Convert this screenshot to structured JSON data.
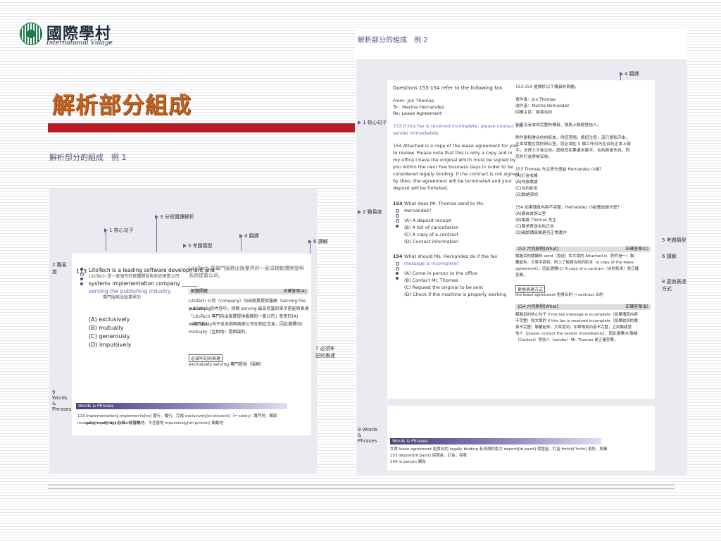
{
  "logo": {
    "cn": "國際學村",
    "en": "International Village"
  },
  "title": "解析部分組成",
  "left": {
    "example_label": "解析部分的組成　例 1",
    "annotations": {
      "a1": "1 核心句子",
      "a2": "2 難易度",
      "a3": "3 分段閱讀解析",
      "a4": "4 翻譯",
      "a5": "5 考題類型",
      "a6": "6 講解",
      "a7": "7 必須牢記的表達",
      "a9": "9 Words & Phrases"
    },
    "question": {
      "number": "113",
      "line1": "LitoTech is a leading software development and",
      "line1_note": "LitoTech 是一家領先的軟體開發與系統建置公司",
      "line2": "systems implementation company ______",
      "line3": "serving the publishing industry.",
      "line3_note": "專門服務出版業界的",
      "options": [
        "(A) exclusively",
        "(B) mutually",
        "(C) generously",
        "(D) impulsively"
      ]
    },
    "translation": "LitoTech 是專門服務出版業界的一家卓越軟體開發與系統建置公司。",
    "analysis_tag": "解題關鍵",
    "analysis_level": "正確答案(A)",
    "analysis_text": [
      "LitoTech 公司（company）向出版業提供服務（serving the publishing",
      "industry）的內容中，修飾 serving 最為恰當的單字是能夠表達",
      "「LitoTech 專門向出版業提供服務的一家公司」意思的(A) exclusively",
      "（專門地）。句子並未指明兩家公司在相互交易，因此選擇(B)",
      "mutually（互相地）是錯誤的。"
    ],
    "memo_label": "必須牢記的表達",
    "memo_text": "exclusively serving 專門提供（服務）",
    "wp_bar": "Words & Phrases",
    "wp_lines": [
      "113  implementation[ˌɪmpləmenˈteʃən] 實行、履行、完成  exclusively[ɪkˈsklusɪvlɪ]（= solely）專門地、獨家  mutually[ˈmjutʃuəlɪ] 互相、相互地",
      "generously[ˈdʒɛnərəslɪ] 慷慨地、不吝嗇地  impulsively[ɪmˈpʌlsɪvlɪ] 衝動地"
    ]
  },
  "right": {
    "example_label": "解析部分的組成　例 2",
    "annotations": {
      "a1": "1 核心句子",
      "a2": "2 難易度",
      "a4": "4 翻譯",
      "a5": "5 考題類型",
      "a6": "6 講解",
      "a8": "8 更換表達方式",
      "a9": "9 Words & Phrases"
    },
    "passage": {
      "header": "Questions 153-154 refer to the following fax.",
      "from": "From: Jon Thomas",
      "to": "To : Marina Hernandez",
      "re": "Re: Lease Agreement",
      "p1": [
        "153 If this fax is received incomplete, please contact the",
        "sender immediately."
      ],
      "p2": [
        "154 Attached is a copy of the lease agreement for you",
        "to review. Please note that this is only a copy and in",
        "my office I have the original which must be signed by",
        "you within the next five business days in order to be",
        "considered legally binding. If the contract is not signed",
        "by then, the agreement will be terminated and your",
        "deposit will be forfeited."
      ]
    },
    "q153": {
      "num": "153",
      "stem": [
        "What does Mr. Thomas send to Ms.",
        "Hernandez?"
      ],
      "options": [
        "(A) A deposit receipt",
        "(B) A bill of cancellation",
        "(C) A copy of a contract",
        "(D) Contact information"
      ]
    },
    "q154": {
      "num": "154",
      "stem": [
        "What should Ms. Hernandez do if the fax",
        "message is incomplete?"
      ],
      "options": [
        "(A) Come in person to the office",
        "(B) Contact Mr. Thomas",
        "(C) Request the original to be sent",
        "(D) Check if the machine is properly working"
      ]
    },
    "translation": [
      "153-154 是關於以下傳真的問題。",
      "",
      "寄件者：Jon Thomas",
      "收件者：Marina Hernandez",
      "回覆主旨：租賃合約",
      "",
      "如果沒有收到完整的傳真，請馬上聯絡發信人。",
      "",
      "附件是租賃合約的影本，供您查閱。請您注意，這只是影印本，",
      "正本保管在我的辦公室。您必須在 5 個工作日內在合約正本上簽",
      "字，法律上才會生效。屆時您如果還未簽字，合約將會失效，而",
      "您的訂金將被沒收。",
      "",
      "153  Thomas 先生寄什麼給 Hernandez 小姐？",
      "(A)訂金收據",
      "(B)作廢票據",
      "(C)合約影本",
      "(D)聯絡資訊",
      "",
      "154  如果傳真內容不完整，Hernandez 小姐應該做什麼？",
      "(A)親自去辦公室",
      "(B)聯絡 Thomas 先生",
      "(C)要求寄送合約正本",
      "(D)確認傳真機是否正常運作"
    ],
    "a153": {
      "head": "153  六何原則[What]",
      "level": "正確答案(C)",
      "lines": [
        "解題目的關鍵詞 send（發送）和文章的 Attached is（附件是～）聯",
        "繫起來，文章中提到，附上了租賃合約的影本（a copy of the lease",
        "agreement），因此選擇(C) A copy of a contract（合約影本）是正確",
        "答案。"
      ]
    },
    "paraphrase_label": "更換表達方式",
    "paraphrase_text": "the lease agreement 租賃合約 → contract 合約",
    "a154": {
      "head": "154  六何原則[What]",
      "level": "正確答案(B)",
      "lines": [
        "解題目的核心句子 if the fax message is incomplete（如果傳真內容",
        "不完整）和文章的 if this fax is received incomplete（如果收到的傳",
        "真不完整）聯繫起來，文章提到，如果傳真內容不完整，立刻聯絡發",
        "信人（please contact the sender immediately），因此選擇(B)聯絡",
        "（Contact）發信人（sender）Mr. Thomas 是正確答案。"
      ]
    },
    "wp_bar": "Words & Phrases",
    "wp_lines": [
      "文章  lease agreement 租賃合約   legally binding 有法律約束力   deposit[dɪˈpazɪt] 保證金、訂金   forfeit[ˈfɔrfɪt] 喪失、放棄",
      "153  deposit[dɪˈpazɪt] 保證金、訂金；存款",
      "154  in person 親自"
    ]
  }
}
